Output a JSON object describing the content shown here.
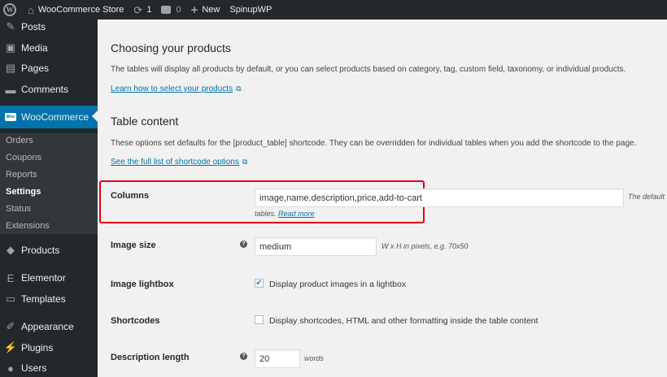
{
  "adminbar": {
    "site_name": "WooCommerce Store",
    "updates_count": "1",
    "comments_count": "0",
    "new_label": "New",
    "spinup_label": "SpinupWP"
  },
  "sidebar": {
    "items": [
      {
        "label": "Posts",
        "icon": "pin-icon"
      },
      {
        "label": "Media",
        "icon": "media-icon"
      },
      {
        "label": "Pages",
        "icon": "pages-icon"
      },
      {
        "label": "Comments",
        "icon": "comments-icon"
      },
      {
        "label": "WooCommerce",
        "icon": "woo-icon"
      },
      {
        "label": "Products",
        "icon": "products-icon"
      },
      {
        "label": "Elementor",
        "icon": "elementor-icon"
      },
      {
        "label": "Templates",
        "icon": "templates-icon"
      },
      {
        "label": "Appearance",
        "icon": "appearance-icon"
      },
      {
        "label": "Plugins",
        "icon": "plugins-icon"
      },
      {
        "label": "Users",
        "icon": "users-icon"
      }
    ],
    "submenu": [
      "Orders",
      "Coupons",
      "Reports",
      "Settings",
      "Status",
      "Extensions"
    ],
    "woo_icon_text": "Woo"
  },
  "content": {
    "section1_title": "Choosing your products",
    "section1_desc": "The tables will display all products by default, or you can select products based on category, tag, custom field, taxonomy, or individual products.",
    "section1_link": "Learn how to select your products",
    "section2_title": "Table content",
    "section2_desc": "These options set defaults for the [product_table] shortcode. They can be overridden for individual tables when you add the shortcode to the page.",
    "section2_link": "See the full list of shortcode options",
    "columns_label": "Columns",
    "columns_value": "image,name,description,price,add-to-cart",
    "columns_after": "The default",
    "columns_after2": "tables.",
    "read_more": "Read more",
    "image_size_label": "Image size",
    "image_size_value": "medium",
    "image_size_hint": "W x H in pixels, e.g. 70x50",
    "lightbox_label": "Image lightbox",
    "lightbox_text": "Display product images in a lightbox",
    "shortcodes_label": "Shortcodes",
    "shortcodes_text": "Display shortcodes, HTML and other formatting inside the table content",
    "desc_length_label": "Description length",
    "desc_length_value": "20",
    "desc_length_unit": "words"
  },
  "colors": {
    "admin_dark": "#23282d",
    "submenu_bg": "#32373c",
    "accent": "#0073aa",
    "highlight_border": "#e0001a"
  }
}
